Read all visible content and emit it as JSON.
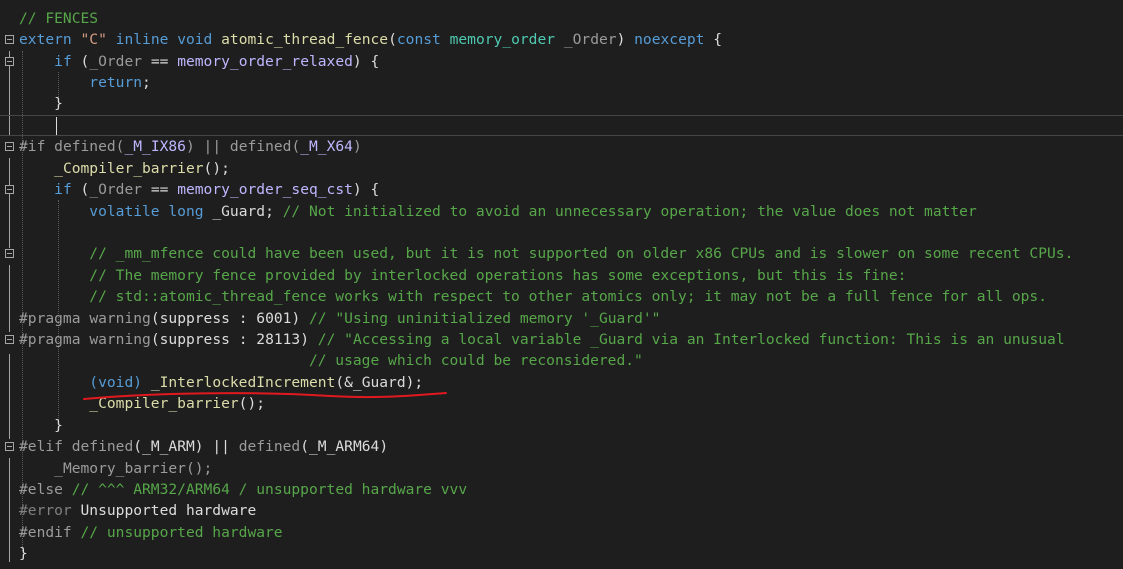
{
  "code": {
    "l1": {
      "a": "// FENCES"
    },
    "l2": {
      "a": "extern",
      "b": " ",
      "c": "\"C\"",
      "d": " ",
      "e": "inline",
      "f": " ",
      "g": "void",
      "h": " ",
      "i": "atomic_thread_fence",
      "j": "(",
      "k": "const",
      "l": " ",
      "m": "memory_order",
      "n": " ",
      "o": "_Order",
      "p": ") ",
      "q": "noexcept",
      "r": " {"
    },
    "l3": {
      "a": "    ",
      "b": "if",
      "c": " (",
      "d": "_Order",
      "e": " == ",
      "f": "memory_order_relaxed",
      "g": ") {"
    },
    "l4": {
      "a": "        ",
      "b": "return",
      "c": ";"
    },
    "l5": {
      "a": "    }"
    },
    "l7": {
      "a": "#if",
      "b": " ",
      "c": "defined",
      "d": "(",
      "e": "_M_IX86",
      "f": ") || ",
      "g": "defined",
      "h": "(",
      "i": "_M_X64",
      "j": ")"
    },
    "l8": {
      "a": "    ",
      "b": "_Compiler_barrier",
      "c": "();"
    },
    "l9": {
      "a": "    ",
      "b": "if",
      "c": " (",
      "d": "_Order",
      "e": " == ",
      "f": "memory_order_seq_cst",
      "g": ") {"
    },
    "l10": {
      "a": "        ",
      "b": "volatile",
      "c": " ",
      "d": "long",
      "e": " ",
      "f": "_Guard",
      "g": "; ",
      "h": "// Not initialized to avoid an unnecessary operation; the value does not matter"
    },
    "l12": {
      "a": "        ",
      "b": "// _mm_mfence could have been used, but it is not supported on older x86 CPUs and is slower on some recent CPUs."
    },
    "l13": {
      "a": "        ",
      "b": "// The memory fence provided by interlocked operations has some exceptions, but this is fine:"
    },
    "l14": {
      "a": "        ",
      "b": "// std::atomic_thread_fence works with respect to other atomics only; it may not be a full fence for all ops."
    },
    "l15": {
      "a": "#pragma",
      "b": " ",
      "c": "warning",
      "d": "(",
      "e": "suppress",
      "f": " : ",
      "g": "6001",
      "h": ") ",
      "i": "// \"Using uninitialized memory '_Guard'\""
    },
    "l16": {
      "a": "#pragma",
      "b": " ",
      "c": "warning",
      "d": "(",
      "e": "suppress",
      "f": " : ",
      "g": "28113",
      "h": ") ",
      "i": "// \"Accessing a local variable _Guard via an Interlocked function: This is an unusual"
    },
    "l17": {
      "a": "                                 ",
      "b": "// usage which could be reconsidered.\""
    },
    "l18": {
      "a": "        ",
      "b": "(void)",
      "c": " ",
      "d": "_InterlockedIncrement",
      "e": "(&",
      "f": "_Guard",
      "g": ");"
    },
    "l19": {
      "a": "        ",
      "b": "_Compiler_barrier",
      "c": "();"
    },
    "l20": {
      "a": "    }"
    },
    "l21": {
      "a": "#elif",
      "b": " ",
      "c": "defined",
      "d": "(",
      "e": "_M_ARM",
      "f": ") || ",
      "g": "defined",
      "h": "(",
      "i": "_M_ARM64",
      "j": ")"
    },
    "l22": {
      "a": "    ",
      "b": "_Memory_barrier",
      "c": "();"
    },
    "l23": {
      "a": "#else",
      "b": " ",
      "c": "// ^^^ ARM32/ARM64 / unsupported hardware vvv"
    },
    "l24": {
      "a": "#error",
      "b": " ",
      "c": "Unsupported hardware"
    },
    "l25": {
      "a": "#endif",
      "b": " ",
      "c": "// unsupported hardware"
    },
    "l26": {
      "a": "}"
    }
  },
  "colors": {
    "background": "#1e1e1e",
    "comment": "#57a64a",
    "keyword": "#569cd6",
    "string": "#d69d85",
    "function": "#dcdcaa",
    "type": "#4ec9b0",
    "parameter": "#9a9a9a",
    "macro": "#beb7ff",
    "annotation_underline": "#e0191e"
  },
  "icons": {
    "fold": "collapse-minus-icon"
  }
}
